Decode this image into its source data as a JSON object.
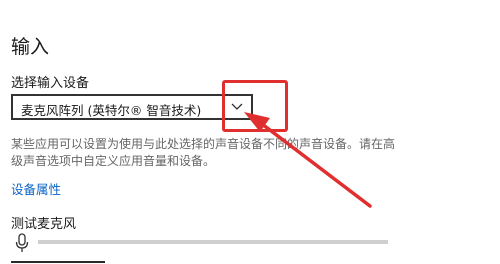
{
  "section": {
    "title": "输入"
  },
  "input_select": {
    "label": "选择输入设备",
    "value": "麦克风阵列 (英特尔® 智音技术)",
    "icon": "chevron-down-icon"
  },
  "description": "某些应用可以设置为使用与此处选择的声音设备不同的声音设备。请在高级声音选项中自定义应用音量和设备。",
  "device_properties_link": "设备属性",
  "test_mic": {
    "label": "测试麦克风",
    "icon": "microphone-icon",
    "level": 0
  },
  "annotation": {
    "color": "#e02f2f"
  },
  "colors": {
    "link": "#0b63c6",
    "accent": "#0078d7"
  }
}
